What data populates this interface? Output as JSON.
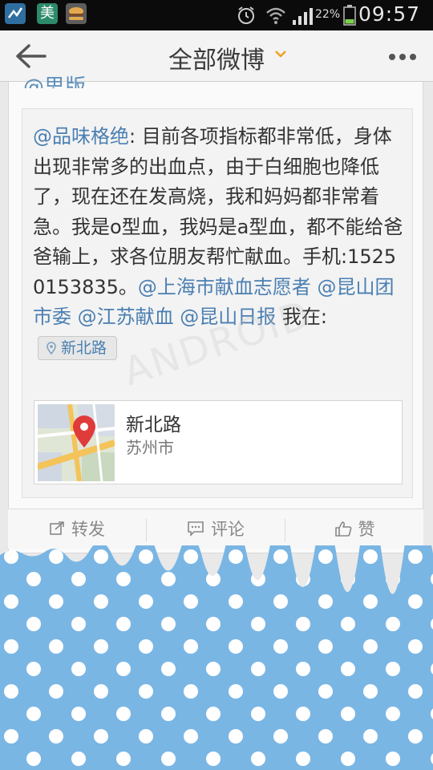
{
  "status_bar": {
    "clock": "09:57",
    "battery_percent": "22%",
    "apps": [
      "app-icon-1",
      "mei-icon",
      "burger-icon"
    ]
  },
  "header": {
    "title": "全部微博"
  },
  "previous_fragment": "@思版",
  "post": {
    "author_mention": "@品味格绝",
    "body": ": 目前各项指标都非常低，身体出现非常多的出血点，由于白细胞也降低了，现在还在发高烧，我和妈妈都非常着急。我是o型血，我妈是a型血，都不能给爸爸输上，求各位朋友帮忙献血。手机:15250153835。",
    "mention_1": "@上海市献血志愿者",
    "mention_2": "@昆山团市委",
    "mention_3": "@江苏献血",
    "mention_4": "@昆山日报",
    "location_prefix": "我在:",
    "location_pill": "新北路"
  },
  "map_card": {
    "place": "新北路",
    "city": "苏州市"
  },
  "actions": {
    "repost": "转发",
    "comment": "评论",
    "like": "赞"
  },
  "watermark": "ANDROID",
  "colors": {
    "link": "#4a7fb2",
    "dots_background": "#7ab6e4",
    "accent_chevron": "#f0a020"
  }
}
